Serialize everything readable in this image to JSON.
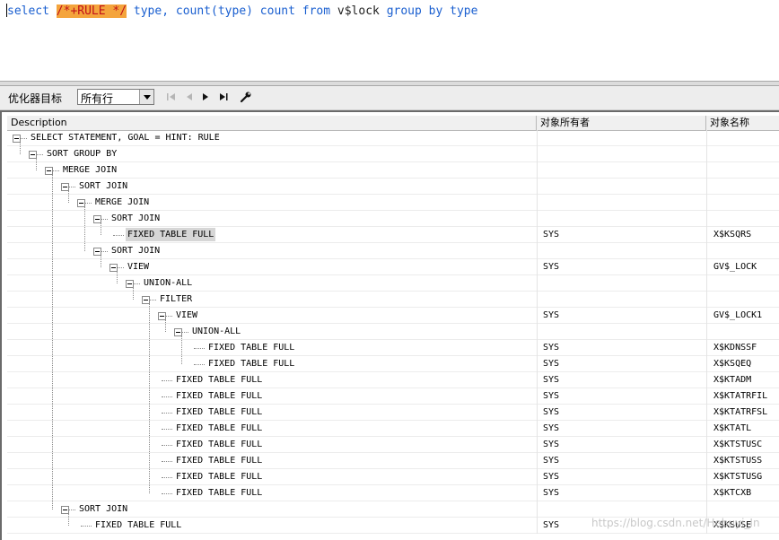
{
  "editor": {
    "tokens": [
      {
        "t": "select",
        "c": "kw"
      },
      {
        "t": " ",
        "c": "plain"
      },
      {
        "t": "/*+RULE */",
        "c": "hint"
      },
      {
        "t": " ",
        "c": "plain"
      },
      {
        "t": "type,",
        "c": "kw"
      },
      {
        "t": " ",
        "c": "plain"
      },
      {
        "t": "count(type)",
        "c": "kw"
      },
      {
        "t": " ",
        "c": "plain"
      },
      {
        "t": "count",
        "c": "kw"
      },
      {
        "t": " ",
        "c": "plain"
      },
      {
        "t": "from",
        "c": "kw"
      },
      {
        "t": " ",
        "c": "plain"
      },
      {
        "t": "v$lock",
        "c": "plain"
      },
      {
        "t": " ",
        "c": "plain"
      },
      {
        "t": "group by",
        "c": "kw"
      },
      {
        "t": " ",
        "c": "plain"
      },
      {
        "t": "type",
        "c": "kw"
      }
    ]
  },
  "toolbar": {
    "optimizer_label": "优化器目标",
    "optimizer_value": "所有行",
    "buttons": [
      "first-icon",
      "prev-icon",
      "next-icon",
      "last-icon",
      "wrench-icon"
    ]
  },
  "grid": {
    "columns": [
      "Description",
      "对象所有者",
      "对象名称"
    ],
    "rows": [
      {
        "depth": 0,
        "op": "SELECT STATEMENT, GOAL = HINT: RULE",
        "owner": "",
        "name": "",
        "toggle": true
      },
      {
        "depth": 1,
        "op": "SORT GROUP BY",
        "owner": "",
        "name": "",
        "toggle": true
      },
      {
        "depth": 2,
        "op": "MERGE JOIN",
        "owner": "",
        "name": "",
        "toggle": true
      },
      {
        "depth": 3,
        "op": "SORT JOIN",
        "owner": "",
        "name": "",
        "toggle": true
      },
      {
        "depth": 4,
        "op": "MERGE JOIN",
        "owner": "",
        "name": "",
        "toggle": true
      },
      {
        "depth": 5,
        "op": "SORT JOIN",
        "owner": "",
        "name": "",
        "toggle": true
      },
      {
        "depth": 6,
        "op": "FIXED TABLE FULL",
        "owner": "SYS",
        "name": "X$KSQRS",
        "toggle": false,
        "selected": true
      },
      {
        "depth": 5,
        "op": "SORT JOIN",
        "owner": "",
        "name": "",
        "toggle": true
      },
      {
        "depth": 6,
        "op": "VIEW",
        "owner": "SYS",
        "name": "GV$_LOCK",
        "toggle": true
      },
      {
        "depth": 7,
        "op": "UNION-ALL",
        "owner": "",
        "name": "",
        "toggle": true
      },
      {
        "depth": 8,
        "op": "FILTER",
        "owner": "",
        "name": "",
        "toggle": true
      },
      {
        "depth": 9,
        "op": "VIEW",
        "owner": "SYS",
        "name": "GV$_LOCK1",
        "toggle": true
      },
      {
        "depth": 10,
        "op": "UNION-ALL",
        "owner": "",
        "name": "",
        "toggle": true
      },
      {
        "depth": 11,
        "op": "FIXED TABLE FULL",
        "owner": "SYS",
        "name": "X$KDNSSF",
        "toggle": false
      },
      {
        "depth": 11,
        "op": "FIXED TABLE FULL",
        "owner": "SYS",
        "name": "X$KSQEQ",
        "toggle": false
      },
      {
        "depth": 9,
        "op": "FIXED TABLE FULL",
        "owner": "SYS",
        "name": "X$KTADM",
        "toggle": false
      },
      {
        "depth": 9,
        "op": "FIXED TABLE FULL",
        "owner": "SYS",
        "name": "X$KTATRFIL",
        "toggle": false
      },
      {
        "depth": 9,
        "op": "FIXED TABLE FULL",
        "owner": "SYS",
        "name": "X$KTATRFSL",
        "toggle": false
      },
      {
        "depth": 9,
        "op": "FIXED TABLE FULL",
        "owner": "SYS",
        "name": "X$KTATL",
        "toggle": false
      },
      {
        "depth": 9,
        "op": "FIXED TABLE FULL",
        "owner": "SYS",
        "name": "X$KTSTUSC",
        "toggle": false
      },
      {
        "depth": 9,
        "op": "FIXED TABLE FULL",
        "owner": "SYS",
        "name": "X$KTSTUSS",
        "toggle": false
      },
      {
        "depth": 9,
        "op": "FIXED TABLE FULL",
        "owner": "SYS",
        "name": "X$KTSTUSG",
        "toggle": false
      },
      {
        "depth": 9,
        "op": "FIXED TABLE FULL",
        "owner": "SYS",
        "name": "X$KTCXB",
        "toggle": false
      },
      {
        "depth": 3,
        "op": "SORT JOIN",
        "owner": "",
        "name": "",
        "toggle": true
      },
      {
        "depth": 4,
        "op": "FIXED TABLE FULL",
        "owner": "SYS",
        "name": "X$KSUSE",
        "toggle": false
      }
    ]
  },
  "watermark": "https://blog.csdn.net/Hehuyi_In"
}
